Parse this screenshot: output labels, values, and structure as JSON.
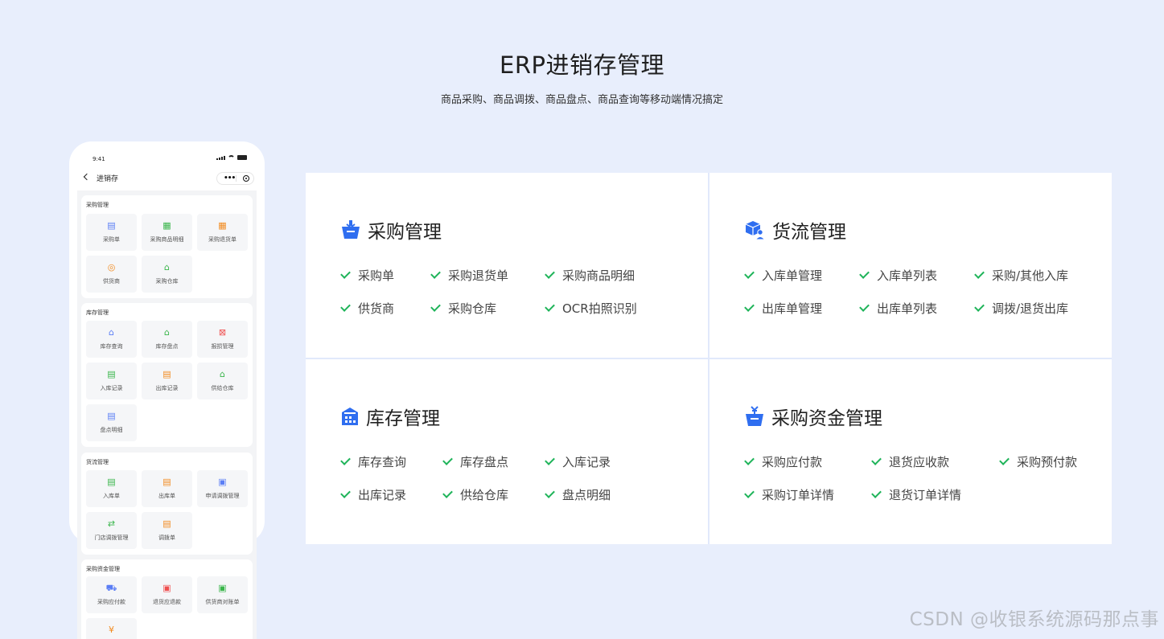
{
  "header": {
    "title": "ERP进销存管理",
    "subtitle": "商品采购、商品调拨、商品盘点、商品查询等移动端情况搞定"
  },
  "phone": {
    "status_time": "9:41",
    "nav_title": "进销存",
    "sections": [
      {
        "title": "采购管理",
        "items": [
          {
            "label": "采购单",
            "icon": "clipboard-icon",
            "color": "blue"
          },
          {
            "label": "采购商品明细",
            "icon": "document-list-icon",
            "color": "green"
          },
          {
            "label": "采购退货单",
            "icon": "return-document-icon",
            "color": "orange"
          },
          {
            "label": "供货商",
            "icon": "supplier-coin-icon",
            "color": "orange"
          },
          {
            "label": "采购仓库",
            "icon": "warehouse-icon",
            "color": "green"
          }
        ]
      },
      {
        "title": "库存管理",
        "items": [
          {
            "label": "库存查询",
            "icon": "house-search-icon",
            "color": "blue"
          },
          {
            "label": "库存盘点",
            "icon": "house-icon",
            "color": "green"
          },
          {
            "label": "报损管理",
            "icon": "trash-icon",
            "color": "red"
          },
          {
            "label": "入库记录",
            "icon": "inbound-record-icon",
            "color": "green"
          },
          {
            "label": "出库记录",
            "icon": "outbound-record-icon",
            "color": "orange"
          },
          {
            "label": "供给仓库",
            "icon": "supply-warehouse-icon",
            "color": "green"
          },
          {
            "label": "盘点明细",
            "icon": "checklist-icon",
            "color": "blue"
          }
        ]
      },
      {
        "title": "货流管理",
        "items": [
          {
            "label": "入库单",
            "icon": "inbound-document-icon",
            "color": "green"
          },
          {
            "label": "出库单",
            "icon": "outbound-document-icon",
            "color": "orange"
          },
          {
            "label": "申请调拨管理",
            "icon": "transfer-request-icon",
            "color": "blue"
          },
          {
            "label": "门店调拨管理",
            "icon": "swap-arrows-icon",
            "color": "green"
          },
          {
            "label": "调拨单",
            "icon": "transfer-document-icon",
            "color": "orange"
          }
        ]
      },
      {
        "title": "采购资金管理",
        "items": [
          {
            "label": "采购应付款",
            "icon": "cart-icon",
            "color": "blue"
          },
          {
            "label": "退货应退款",
            "icon": "refund-icon",
            "color": "red"
          },
          {
            "label": "供货商对账单",
            "icon": "statement-icon",
            "color": "green"
          },
          {
            "label": "",
            "icon": "yen-icon",
            "color": "orange"
          }
        ]
      }
    ]
  },
  "panels": [
    {
      "title": "采购管理",
      "icon": "basket-icon",
      "features": [
        "采购单",
        "采购退货单",
        "采购商品明细",
        "供货商",
        "采购仓库",
        "OCR拍照识别"
      ]
    },
    {
      "title": "货流管理",
      "icon": "box-user-icon",
      "features": [
        "入库单管理",
        "入库单列表",
        "采购/其他入库",
        "出库单管理",
        "出库单列表",
        "调拨/退货出库"
      ]
    },
    {
      "title": "库存管理",
      "icon": "warehouse-building-icon",
      "features": [
        "库存查询",
        "库存盘点",
        "入库记录",
        "出库记录",
        "供给仓库",
        "盘点明细"
      ]
    },
    {
      "title": "采购资金管理",
      "icon": "money-basket-icon",
      "features": [
        "采购应付款",
        "退货应收款",
        "采购预付款",
        "采购订单详情",
        "退货订单详情"
      ]
    }
  ],
  "colors": {
    "background": "#e8eefc",
    "accent_blue": "#2f6ef0",
    "check_green": "#1fb45a"
  },
  "watermark": "CSDN @收银系统源码那点事"
}
